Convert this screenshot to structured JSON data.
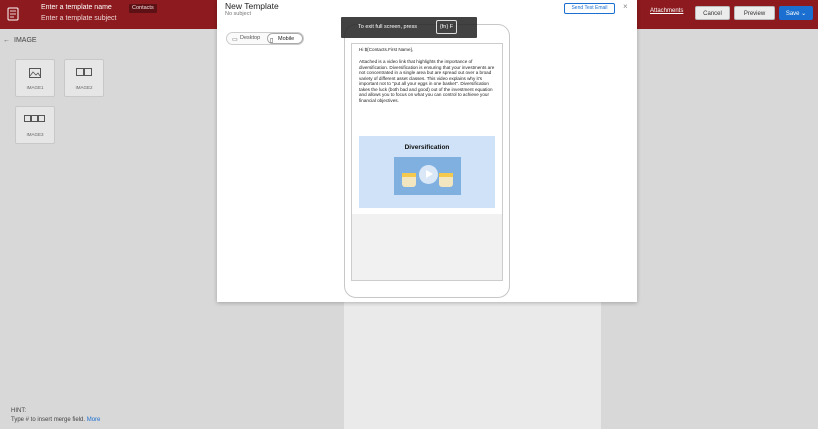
{
  "header": {
    "template_name": "Enter a template name",
    "template_subject": "Enter a template subject",
    "merge_chip": "Contacts",
    "attachments_link": "Attachments",
    "cancel_label": "Cancel",
    "preview_label": "Preview",
    "save_label": "Save ⌄"
  },
  "left_panel": {
    "back_arrow": "←",
    "section_title": "IMAGE",
    "tiles": [
      {
        "label": "IMAGE1",
        "icon": "single-image-icon"
      },
      {
        "label": "IMAGE2",
        "icon": "two-images-icon"
      },
      {
        "label": "IMAGE3",
        "icon": "three-images-icon"
      }
    ],
    "hint_title": "HINT:",
    "hint_text": "Type # to insert merge field.",
    "hint_more": "More"
  },
  "modal": {
    "title": "New Template",
    "subtitle": "No subject",
    "send_test_label": "Send Test Email",
    "close_glyph": "×",
    "view_toggle": {
      "desktop": "Desktop",
      "mobile": "Mobile",
      "selected": "Mobile"
    }
  },
  "preview": {
    "greeting": "Hi ${Contacts.First Name},",
    "body": "Attached is a video link that highlights the importance of diversification. Diversification is ensuring that your investments are not concentrated in a single area but are spread out over a broad variety of different asset classes. This video explains why it's important not to \"put all your eggs in one basket\". Diversification takes the luck (both bad and good) out of the investment equation and allows you to focus on what you can control to achieve your financial objectives.",
    "video_title": "Diversification"
  },
  "fullscreen_toast": {
    "message": "To exit full screen, press",
    "key": "{fn} F"
  },
  "colors": {
    "header_bg": "#8c1a1e",
    "accent_blue": "#1b6fd0",
    "video_card_bg": "#cfe2f7"
  }
}
